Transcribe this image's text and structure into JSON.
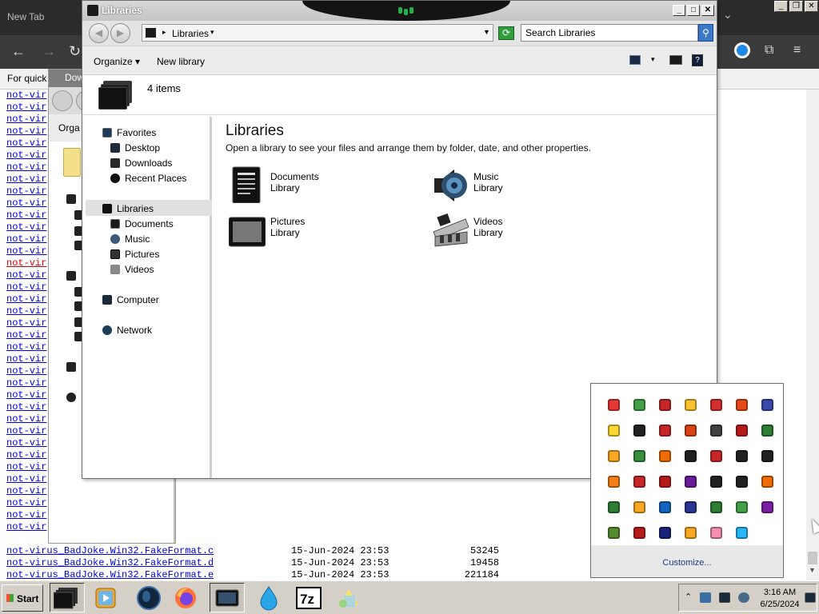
{
  "browser": {
    "tab_title": "New Tab",
    "info_text": "For quick",
    "listing_prefix": "not-vir",
    "listing_count": 37,
    "listing_red_index": 14,
    "files": [
      {
        "name": "not-virus_BadJoke.Win32.FakeFormat.c",
        "date": "15-Jun-2024 23:53",
        "size": "53245"
      },
      {
        "name": "not-virus_BadJoke.Win32.FakeFormat.d",
        "date": "15-Jun-2024 23:53",
        "size": "19458"
      },
      {
        "name": "not-virus_BadJoke.Win32.FakeFormat.e",
        "date": "15-Jun-2024 23:53",
        "size": "221184"
      }
    ]
  },
  "bg_window": {
    "title": "Dow",
    "toolbar_label": "Orga"
  },
  "libraries_window": {
    "title": "Libraries",
    "address_crumb": "Libraries",
    "search_placeholder": "Search Libraries",
    "commands": {
      "organize": "Organize",
      "new_library": "New library"
    },
    "item_count": "4 items",
    "heading": "Libraries",
    "subtitle": "Open a library to see your files and arrange them by folder, date, and other properties.",
    "nav": {
      "favorites": "Favorites",
      "desktop": "Desktop",
      "downloads": "Downloads",
      "recent_places": "Recent Places",
      "libraries": "Libraries",
      "documents": "Documents",
      "music": "Music",
      "pictures": "Pictures",
      "videos": "Videos",
      "computer": "Computer",
      "network": "Network"
    },
    "libraries": [
      {
        "name": "Documents",
        "kind": "Library",
        "icon": "documents-library-icon"
      },
      {
        "name": "Music",
        "kind": "Library",
        "icon": "music-library-icon"
      },
      {
        "name": "Pictures",
        "kind": "Library",
        "icon": "pictures-library-icon"
      },
      {
        "name": "Videos",
        "kind": "Library",
        "icon": "videos-library-icon"
      }
    ]
  },
  "tray_popup": {
    "customize_label": "Customize...",
    "icon_colors": [
      "#e53935",
      "#43a047",
      "#c62828",
      "#fbc02d",
      "#d32f2f",
      "#e64a19",
      "#3949ab",
      "#fdd835",
      "#212121",
      "#c62828",
      "#d84315",
      "#424242",
      "#b71c1c",
      "#2e7d32",
      "#f9a825",
      "#388e3c",
      "#ef6c00",
      "#212121",
      "#c62828",
      "#212121",
      "#212121",
      "#f57f17",
      "#c62828",
      "#b71c1c",
      "#6a1b9a",
      "#212121",
      "#212121",
      "#ef6c00",
      "#2e7d32",
      "#f9a825",
      "#1565c0",
      "#283593",
      "#2e7d32",
      "#43a047",
      "#7b1fa2",
      "#558b2f",
      "#b71c1c",
      "#1a237e",
      "#f9a825",
      "#f48fb1",
      "#29b6f6"
    ]
  },
  "taskbar": {
    "start_label": "Start",
    "clock_time": "3:16 AM",
    "clock_date": "6/25/2024",
    "apps": [
      "libraries-icon",
      "media-player-icon",
      "globe-icon",
      "firefox-icon",
      "explorer-icon",
      "water-drop-icon",
      "7zip-icon",
      "paint-icon"
    ]
  }
}
